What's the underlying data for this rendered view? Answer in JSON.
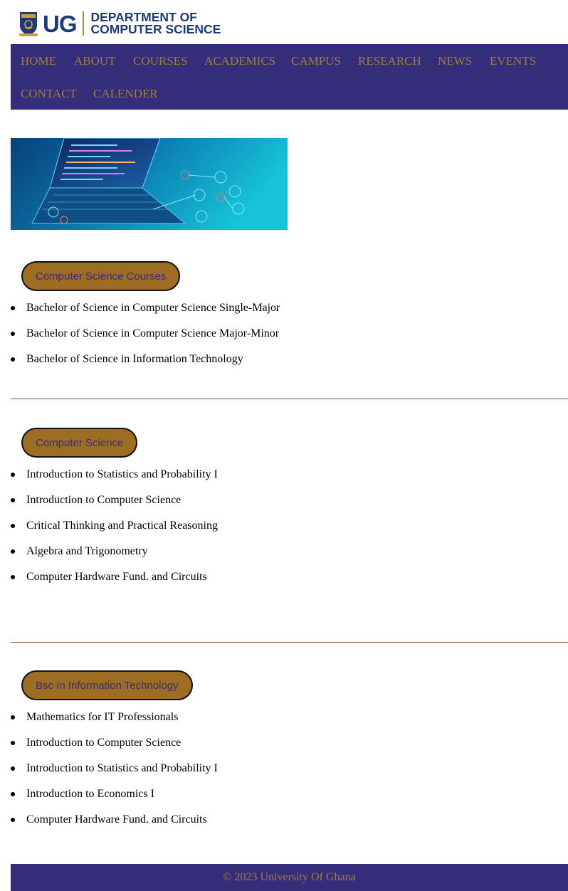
{
  "brand": {
    "short": "UG",
    "dept_line1": "DEPARTMENT OF",
    "dept_line2": "COMPUTER SCIENCE"
  },
  "nav": {
    "items": [
      {
        "label": "HOME"
      },
      {
        "label": "ABOUT"
      },
      {
        "label": "COURSES"
      },
      {
        "label": "ACADEMICS"
      },
      {
        "label": "CAMPUS"
      },
      {
        "label": "RESEARCH"
      },
      {
        "label": "NEWS"
      },
      {
        "label": "EVENTS"
      },
      {
        "label": "CONTACT"
      },
      {
        "label": "CALENDER"
      }
    ]
  },
  "sections": [
    {
      "button": "Computer Science Courses",
      "items": [
        "Bachelor of Science in Computer Science Single-Major",
        "Bachelor of Science in Computer Science Major-Minor",
        "Bachelor of Science in Information Technology"
      ]
    },
    {
      "button": "Computer Science",
      "items": [
        "Introduction to Statistics and Probability I",
        "Introduction to Computer Science",
        "Critical Thinking and Practical Reasoning",
        "Algebra and Trigonometry",
        "Computer Hardware Fund. and Circuits"
      ]
    },
    {
      "button": "Bsc In Information Technology",
      "items": [
        "Mathematics for IT Professionals",
        "Introduction to Computer Science",
        "Introduction to Statistics and Probability I",
        "Introduction to Economics I",
        "Computer Hardware Fund. and Circuits"
      ]
    }
  ],
  "footer": {
    "text": "© 2023 University Of Ghana"
  },
  "colors": {
    "nav_bg": "#342e7a",
    "nav_text": "#a57d3a",
    "button_bg": "#9c6d22",
    "button_text": "#3a2d7a",
    "brand_blue": "#1f3a7a"
  }
}
